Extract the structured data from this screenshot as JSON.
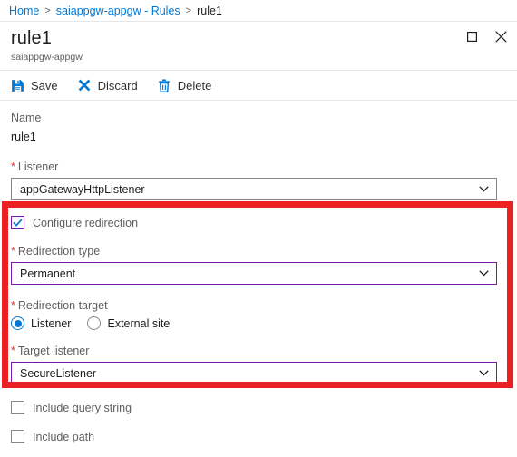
{
  "breadcrumb": {
    "items": [
      {
        "label": "Home",
        "link": true
      },
      {
        "label": "saiappgw-appgw - Rules",
        "link": true
      },
      {
        "label": "rule1",
        "link": false
      }
    ],
    "separator": ">"
  },
  "header": {
    "title": "rule1",
    "subtitle": "saiappgw-appgw",
    "maximize_icon": "maximize-square-icon",
    "close_icon": "close-x-icon"
  },
  "toolbar": {
    "save_label": "Save",
    "save_icon": "save-floppy-icon",
    "discard_label": "Discard",
    "discard_icon": "discard-x-icon",
    "delete_label": "Delete",
    "delete_icon": "delete-trash-icon"
  },
  "form": {
    "name_label": "Name",
    "name_value": "rule1",
    "listener_label": "Listener",
    "listener_value": "appGatewayHttpListener",
    "configure_redirection_label": "Configure redirection",
    "configure_redirection_checked": true,
    "redirection_type_label": "Redirection type",
    "redirection_type_value": "Permanent",
    "redirection_target_label": "Redirection target",
    "radio_listener_label": "Listener",
    "radio_external_label": "External site",
    "radio_selected": "Listener",
    "target_listener_label": "Target listener",
    "target_listener_value": "SecureListener",
    "include_query_string_label": "Include query string",
    "include_query_string_checked": false,
    "include_path_label": "Include path",
    "include_path_checked": false,
    "required_marker": "*",
    "chevron_icon": "chevron-down-icon"
  },
  "annotation": {
    "highlight_color": "#ed2024"
  }
}
